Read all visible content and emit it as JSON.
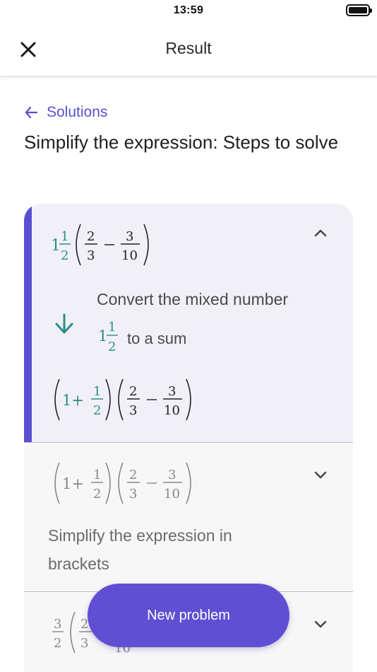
{
  "status_bar": {
    "time": "13:59"
  },
  "header": {
    "title": "Result"
  },
  "nav": {
    "back_label": "Solutions"
  },
  "page": {
    "title": "Simplify the expression: Steps to solve"
  },
  "steps": [
    {
      "expression_parts": [
        "1",
        "1",
        "2",
        "2",
        "3",
        "3",
        "10"
      ],
      "description": "Convert the mixed number",
      "description_mixed": [
        "1",
        "1",
        "2"
      ],
      "description_suffix": "to a sum",
      "result_parts": [
        "1+",
        "1",
        "2",
        "2",
        "3",
        "3",
        "10"
      ],
      "expanded": true
    },
    {
      "expression_parts": [
        "1+",
        "1",
        "2",
        "2",
        "3",
        "3",
        "10"
      ],
      "description": "Simplify the expression in brackets",
      "expanded": false
    },
    {
      "expression_parts": [
        "3",
        "2",
        "2",
        "3",
        "10"
      ],
      "expanded": false
    }
  ],
  "actions": {
    "new_problem_label": "New problem"
  },
  "colors": {
    "accent": "#5b4fd1",
    "teal": "#2a8f84",
    "button": "#5f50d3"
  }
}
